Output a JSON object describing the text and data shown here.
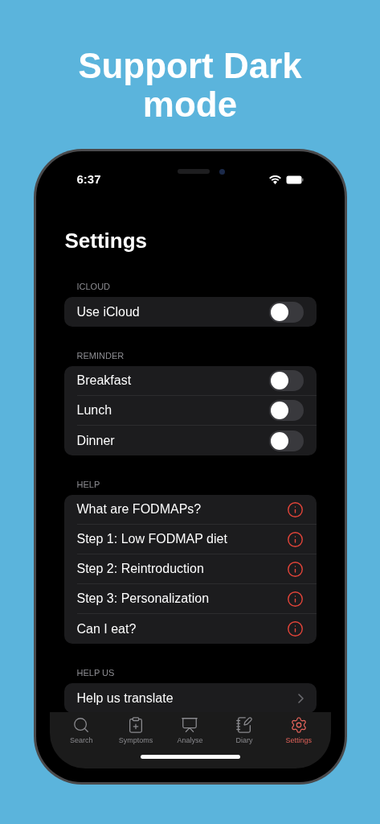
{
  "headline": "Support Dark mode",
  "status_bar": {
    "time": "6:37"
  },
  "title": "Settings",
  "sections": [
    {
      "header": "ICLOUD",
      "rows": [
        {
          "label": "Use iCloud",
          "kind": "toggle",
          "on": false
        }
      ]
    },
    {
      "header": "REMINDER",
      "rows": [
        {
          "label": "Breakfast",
          "kind": "toggle",
          "on": false
        },
        {
          "label": "Lunch",
          "kind": "toggle",
          "on": false
        },
        {
          "label": "Dinner",
          "kind": "toggle",
          "on": false
        }
      ]
    },
    {
      "header": "HELP",
      "rows": [
        {
          "label": "What are FODMAPs?",
          "kind": "info"
        },
        {
          "label": "Step 1: Low FODMAP diet",
          "kind": "info"
        },
        {
          "label": "Step 2: Reintroduction",
          "kind": "info"
        },
        {
          "label": "Step 3: Personalization",
          "kind": "info"
        },
        {
          "label": "Can I eat?",
          "kind": "info"
        }
      ]
    },
    {
      "header": "HELP US",
      "rows": [
        {
          "label": "Help us translate",
          "kind": "link"
        }
      ]
    }
  ],
  "tab_bar": [
    {
      "label": "Search",
      "kind": "search",
      "selected": false
    },
    {
      "label": "Symptoms",
      "kind": "symptoms",
      "selected": false
    },
    {
      "label": "Analyse",
      "kind": "analyse",
      "selected": false
    },
    {
      "label": "Diary",
      "kind": "diary",
      "selected": false
    },
    {
      "label": "Settings",
      "kind": "settings",
      "selected": true
    }
  ]
}
